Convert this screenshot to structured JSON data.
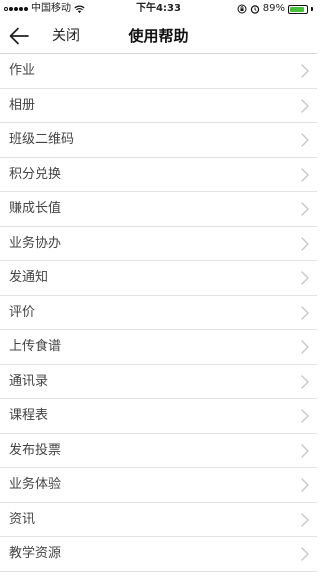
{
  "status_bar": {
    "carrier": "中国移动",
    "time": "下午4:33",
    "battery": "89%",
    "battery_level": 0.89,
    "signal_icon": "signal-dots-icon",
    "wifi_icon": "wifi-icon",
    "lock_icon": "orientation-lock-icon",
    "alarm_icon": "alarm-icon"
  },
  "nav": {
    "back_icon": "arrow-left-icon",
    "close_label": "关闭",
    "title": "使用帮助"
  },
  "help_items": [
    {
      "label": "作业"
    },
    {
      "label": "相册"
    },
    {
      "label": "班级二维码"
    },
    {
      "label": "积分兑换"
    },
    {
      "label": "赚成长值"
    },
    {
      "label": "业务协办"
    },
    {
      "label": "发通知"
    },
    {
      "label": "评价"
    },
    {
      "label": "上传食谱"
    },
    {
      "label": "通讯录"
    },
    {
      "label": "课程表"
    },
    {
      "label": "发布投票"
    },
    {
      "label": "业务体验"
    },
    {
      "label": "资讯"
    },
    {
      "label": "教学资源"
    }
  ],
  "colors": {
    "battery_fill": "#44c03a",
    "divider": "#e2e2e2",
    "chevron": "#c7c7cc"
  }
}
